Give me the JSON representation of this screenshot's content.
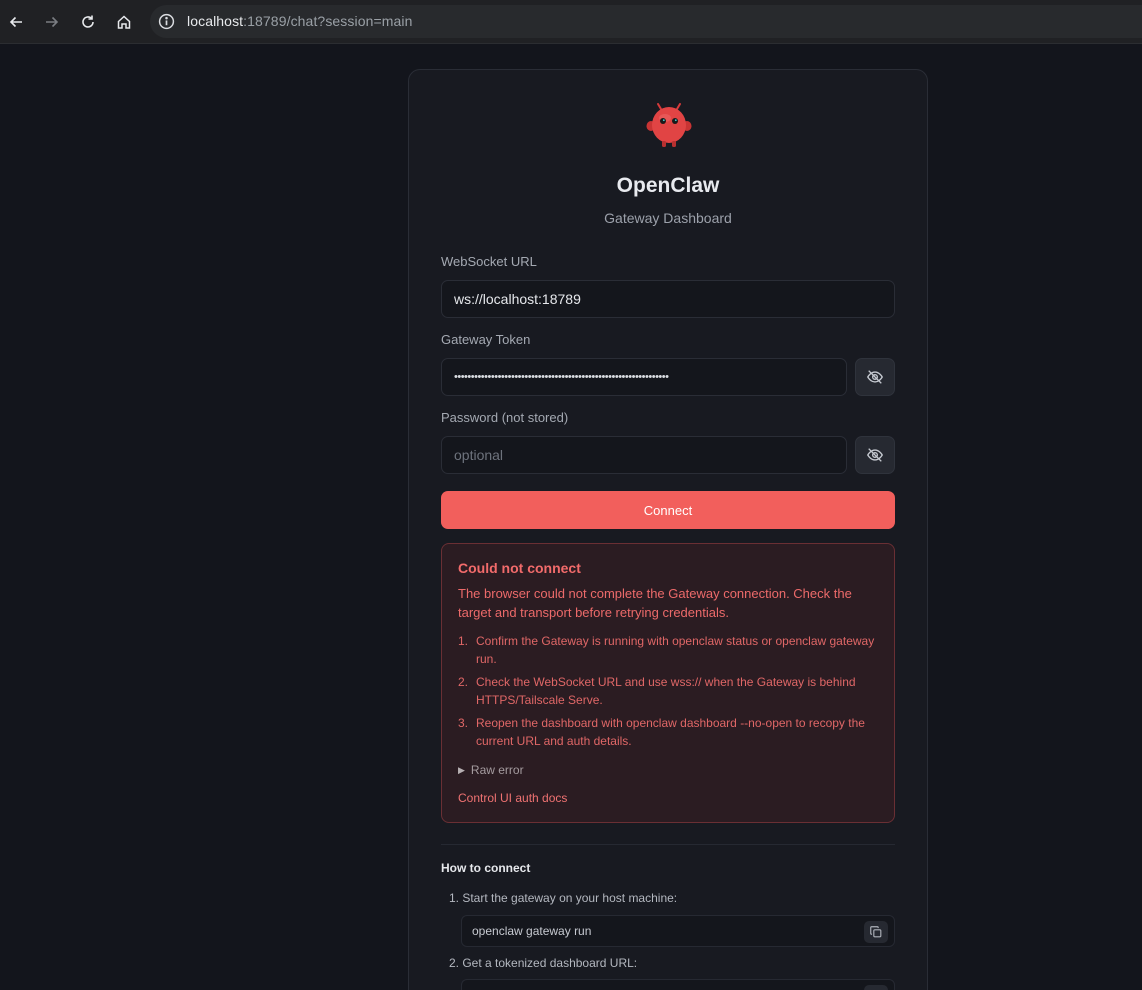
{
  "browser": {
    "url_host": "localhost",
    "url_path": ":18789/chat?session=main"
  },
  "brand": {
    "name": "OpenClaw",
    "subtitle": "Gateway Dashboard"
  },
  "form": {
    "websocket_label": "WebSocket URL",
    "websocket_value": "ws://localhost:18789",
    "token_label": "Gateway Token",
    "token_value": "••••••••••••••••••••••••••••••••••••••••••••••••••••••••••••••••",
    "password_label": "Password (not stored)",
    "password_placeholder": "optional",
    "connect_label": "Connect"
  },
  "error": {
    "title": "Could not connect",
    "description": "The browser could not complete the Gateway connection. Check the target and transport before retrying credentials.",
    "steps": [
      {
        "num": "1.",
        "text": "Confirm the Gateway is running with openclaw status or openclaw gateway run."
      },
      {
        "num": "2.",
        "text": "Check the WebSocket URL and use wss:// when the Gateway is behind HTTPS/Tailscale Serve."
      },
      {
        "num": "3.",
        "text": "Reopen the dashboard with openclaw dashboard --no-open to recopy the current URL and auth details."
      }
    ],
    "raw_error_label": "Raw error",
    "docs_link": "Control UI auth docs"
  },
  "how_to": {
    "title": "How to connect",
    "step1": "1. Start the gateway on your host machine:",
    "step1_code": "openclaw gateway run",
    "step2": "2. Get a tokenized dashboard URL:"
  },
  "colors": {
    "accent": "#f25f5c",
    "error_text": "#f26b6b",
    "background": "#13151c",
    "card": "#181a21"
  },
  "icons": {
    "back": "arrow-left-icon",
    "forward": "arrow-right-icon",
    "reload": "reload-icon",
    "home": "home-icon",
    "site_info": "info-icon",
    "toggle_visibility": "eye-off-icon",
    "copy": "copy-icon",
    "logo": "lobster-robot-logo"
  }
}
